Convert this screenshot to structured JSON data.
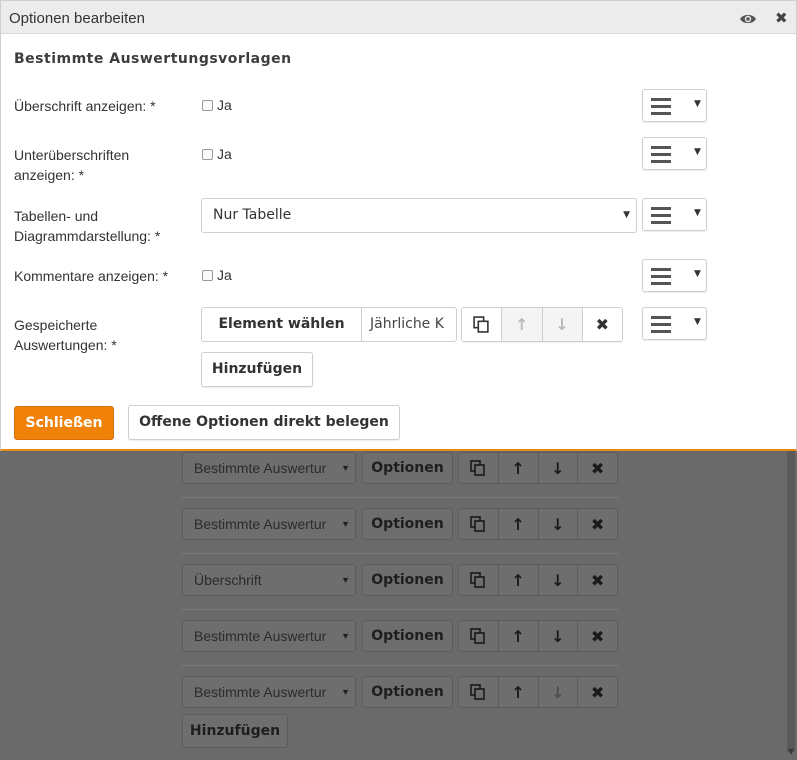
{
  "dialog": {
    "title": "Optionen bearbeiten",
    "section_title": "Bestimmte Auswertungsvorlagen",
    "fields": {
      "show_heading_label": "Überschrift anzeigen: *",
      "show_subheadings_label_line1": "Unterüberschriften",
      "show_subheadings_label_line2": "anzeigen: *",
      "display_label_line1": "Tabellen- und",
      "display_label_line2": "Diagrammdarstellung: *",
      "comments_label": "Kommentare anzeigen: *",
      "saved_label_line1": "Gespeicherte",
      "saved_label_line2": "Auswertungen: *",
      "checkbox_label": "Ja",
      "display_value": "Nur Tabelle",
      "choose_element_label": "Element wählen",
      "element_value": "Jährliche K",
      "add_label": "Hinzufügen"
    },
    "footer": {
      "close_label": "Schließen",
      "assign_label": "Offene Optionen direkt belegen"
    }
  },
  "background": {
    "rows": [
      {
        "select": "Bestimmte Auswertur",
        "button": "Optionen"
      },
      {
        "select": "Bestimmte Auswertur",
        "button": "Optionen"
      },
      {
        "select": "Überschrift",
        "button": "Optionen"
      },
      {
        "select": "Bestimmte Auswertur",
        "button": "Optionen"
      },
      {
        "select": "Bestimmte Auswertur",
        "button": "Optionen"
      }
    ],
    "add_label": "Hinzufügen"
  },
  "colors": {
    "primary": "#f0820a",
    "accent_border": "#e58b1e"
  }
}
